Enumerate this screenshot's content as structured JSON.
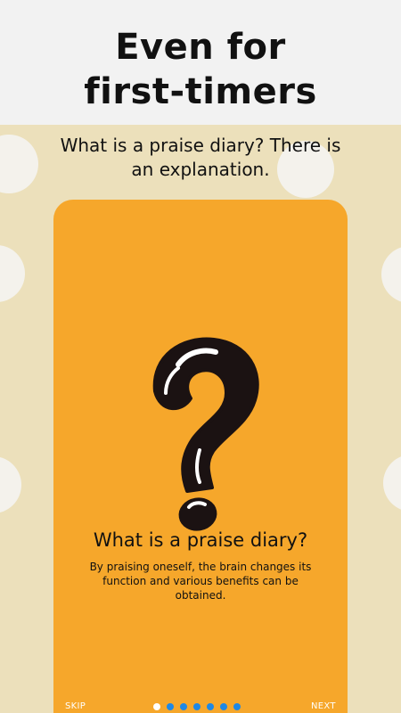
{
  "header": {
    "headline_line1": "Even for",
    "headline_line2": "first-timers"
  },
  "subtitle": {
    "line1": "What is a praise diary? There is",
    "line2": "an explanation."
  },
  "card": {
    "icon": "question-mark-icon",
    "title": "What is a praise diary?",
    "body_line1": "By praising oneself, the brain changes its",
    "body_line2": "function and various benefits can be obtained."
  },
  "footer": {
    "skip_label": "SKIP",
    "next_label": "NEXT",
    "pager": {
      "total_pages": 7,
      "current_page": 1
    }
  },
  "colors": {
    "background": "#ece0bb",
    "header_band": "#f2f2f2",
    "card": "#f6a72b",
    "decor_dots": "#f4f2ec",
    "pager_active": "#ffffff",
    "pager_inactive": "#1e88e5",
    "text": "#111111"
  }
}
